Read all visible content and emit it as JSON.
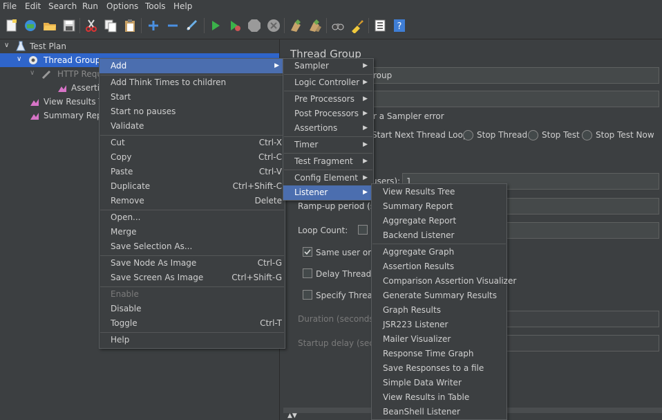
{
  "menubar": [
    "File",
    "Edit",
    "Search",
    "Run",
    "Options",
    "Tools",
    "Help"
  ],
  "tree": {
    "test_plan": "Test Plan",
    "thread_group": "Thread Group",
    "http_request": "HTTP Reque",
    "assertion": "Assertic",
    "view_results": "View Results Tre",
    "summary": "Summary Repo"
  },
  "panel": {
    "title": "Thread Group",
    "name_value": "roup",
    "error_label": "r a Sampler error",
    "radios": [
      "Start Next Thread Loop",
      "Stop Thread",
      "Stop Test",
      "Stop Test Now"
    ],
    "threads_label": "users):",
    "threads_value": "1",
    "ramp_label": "Ramp-up period (se",
    "loop_label": "Loop Count:",
    "same_user": "Same user on e",
    "delay": "Delay Thread c",
    "specify": "Specify Thread",
    "duration": "Duration (seconds):",
    "startup": "Startup delay (secon"
  },
  "context_menu": {
    "add": "Add",
    "think_times": "Add Think Times to children",
    "start": "Start",
    "start_no_pauses": "Start no pauses",
    "validate": "Validate",
    "cut": "Cut",
    "cut_sc": "Ctrl-X",
    "copy": "Copy",
    "copy_sc": "Ctrl-C",
    "paste": "Paste",
    "paste_sc": "Ctrl-V",
    "duplicate": "Duplicate",
    "duplicate_sc": "Ctrl+Shift-C",
    "remove": "Remove",
    "remove_sc": "Delete",
    "open": "Open...",
    "merge": "Merge",
    "save_selection": "Save Selection As...",
    "save_node": "Save Node As Image",
    "save_node_sc": "Ctrl-G",
    "save_screen": "Save Screen As Image",
    "save_screen_sc": "Ctrl+Shift-G",
    "enable": "Enable",
    "disable": "Disable",
    "toggle": "Toggle",
    "toggle_sc": "Ctrl-T",
    "help": "Help"
  },
  "add_menu": {
    "sampler": "Sampler",
    "logic": "Logic Controller",
    "pre": "Pre Processors",
    "post": "Post Processors",
    "assertions": "Assertions",
    "timer": "Timer",
    "fragment": "Test Fragment",
    "config": "Config Element",
    "listener": "Listener"
  },
  "listener_menu": {
    "group1": [
      "View Results Tree",
      "Summary Report",
      "Aggregate Report",
      "Backend Listener"
    ],
    "group2": [
      "Aggregate Graph",
      "Assertion Results",
      "Comparison Assertion Visualizer",
      "Generate Summary Results",
      "Graph Results",
      "JSR223 Listener",
      "Mailer Visualizer",
      "Response Time Graph",
      "Save Responses to a file",
      "Simple Data Writer",
      "View Results in Table",
      "BeanShell Listener"
    ]
  }
}
